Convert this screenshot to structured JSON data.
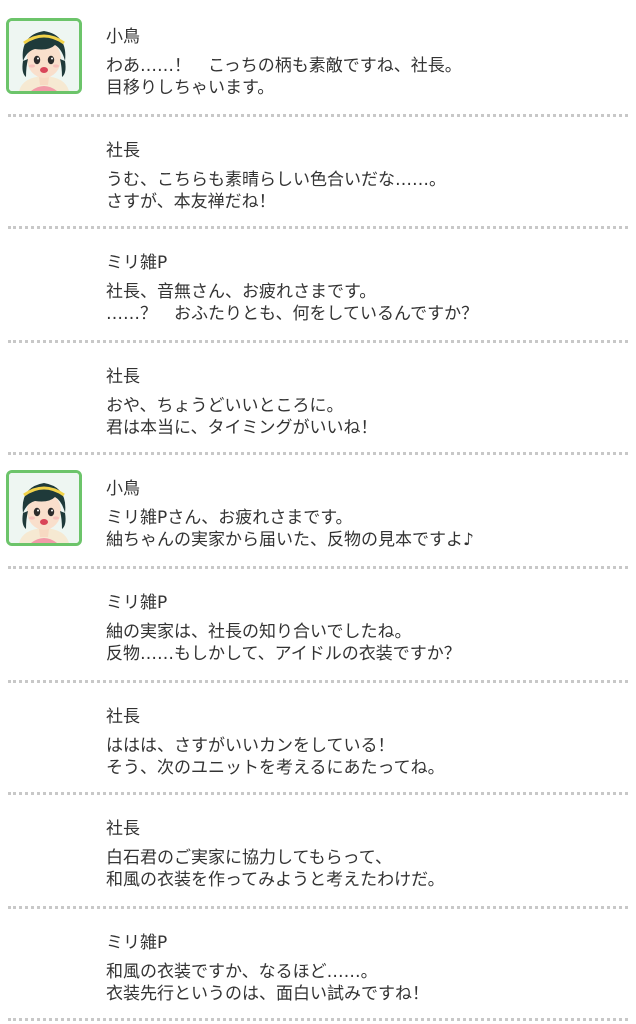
{
  "dialog_log": [
    {
      "speaker": "小鳥",
      "avatar": "kotori-portrait",
      "lines": [
        "わあ……！　こっちの柄も素敵ですね、社長。",
        "目移りしちゃいます。"
      ]
    },
    {
      "speaker": "社長",
      "lines": [
        "うむ、こちらも素晴らしい色合いだな……。",
        "さすが、本友禅だね！"
      ]
    },
    {
      "speaker": "ミリ雑P",
      "lines": [
        "社長、音無さん、お疲れさまです。",
        "……？　おふたりとも、何をしているんですか？"
      ]
    },
    {
      "speaker": "社長",
      "lines": [
        "おや、ちょうどいいところに。",
        "君は本当に、タイミングがいいね！"
      ]
    },
    {
      "speaker": "小鳥",
      "avatar": "kotori-portrait",
      "lines": [
        "ミリ雑Pさん、お疲れさまです。",
        "紬ちゃんの実家から届いた、反物の見本ですよ♪"
      ]
    },
    {
      "speaker": "ミリ雑P",
      "lines": [
        "紬の実家は、社長の知り合いでしたね。",
        "反物……もしかして、アイドルの衣装ですか？"
      ]
    },
    {
      "speaker": "社長",
      "lines": [
        "ははは、さすがいいカンをしている！",
        "そう、次のユニットを考えるにあたってね。"
      ]
    },
    {
      "speaker": "社長",
      "lines": [
        "白石君のご実家に協力してもらって、",
        "和風の衣装を作ってみようと考えたわけだ。"
      ]
    },
    {
      "speaker": "ミリ雑P",
      "lines": [
        "和風の衣装ですか、なるほど……。",
        "衣装先行というのは、面白い試みですね！"
      ]
    }
  ],
  "colors": {
    "avatar_border": "#6cc46a",
    "separator": "#c8c8c8",
    "text": "#333333"
  }
}
